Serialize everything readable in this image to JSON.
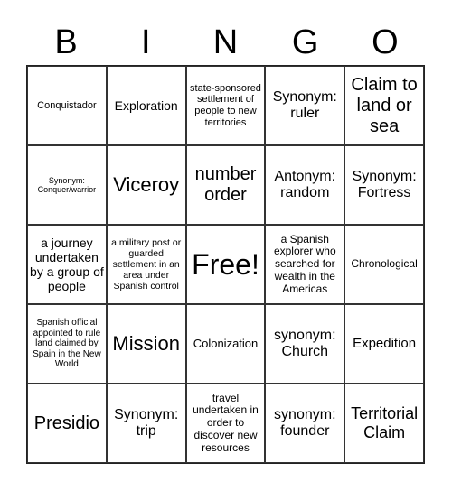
{
  "header": [
    "B",
    "I",
    "N",
    "G",
    "O"
  ],
  "cells": [
    "Conquistador",
    "Exploration",
    "state-sponsored settlement of people to new territories",
    "Synonym: ruler",
    "Claim to land or sea",
    "Synonym: Conquer/warrior",
    "Viceroy",
    "number order",
    "Antonym: random",
    "Synonym: Fortress",
    "a journey undertaken by a group of people",
    "a military post or guarded settlement in an area under Spanish control",
    "Free!",
    "a Spanish explorer who searched for wealth in the Americas",
    "Chronological",
    "Spanish official appointed to rule land claimed by Spain in the New World",
    "Mission",
    "Colonization",
    "synonym: Church",
    "Expedition",
    "Presidio",
    "Synonym: trip",
    "travel undertaken in order to discover new resources",
    "synonym: founder",
    "Territorial Claim"
  ]
}
